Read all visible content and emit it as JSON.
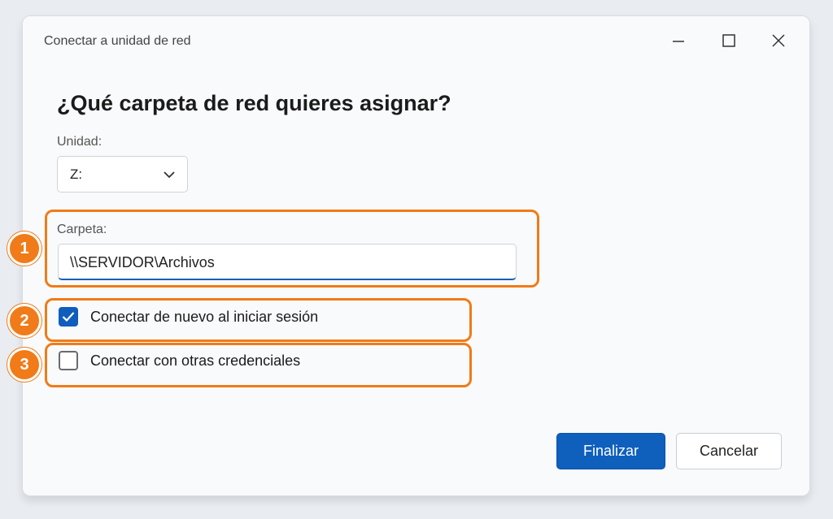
{
  "window": {
    "title": "Conectar a unidad de red",
    "minimize_icon": "minimize-icon",
    "maximize_icon": "maximize-icon",
    "close_icon": "close-icon"
  },
  "main": {
    "heading": "¿Qué carpeta de red quieres asignar?",
    "drive": {
      "label": "Unidad:",
      "value": "Z:",
      "icon": "chevron-down-icon"
    },
    "folder": {
      "label": "Carpeta:",
      "value": "\\\\SERVIDOR\\Archivos"
    },
    "options": [
      {
        "label": "Conectar de nuevo al iniciar sesión",
        "checked": true
      },
      {
        "label": "Conectar con otras credenciales",
        "checked": false
      }
    ]
  },
  "annotations": {
    "color": "#f07b18",
    "badges": [
      "1",
      "2",
      "3"
    ]
  },
  "footer": {
    "finish_label": "Finalizar",
    "cancel_label": "Cancelar"
  },
  "colors": {
    "accent": "#0f5fbd"
  }
}
